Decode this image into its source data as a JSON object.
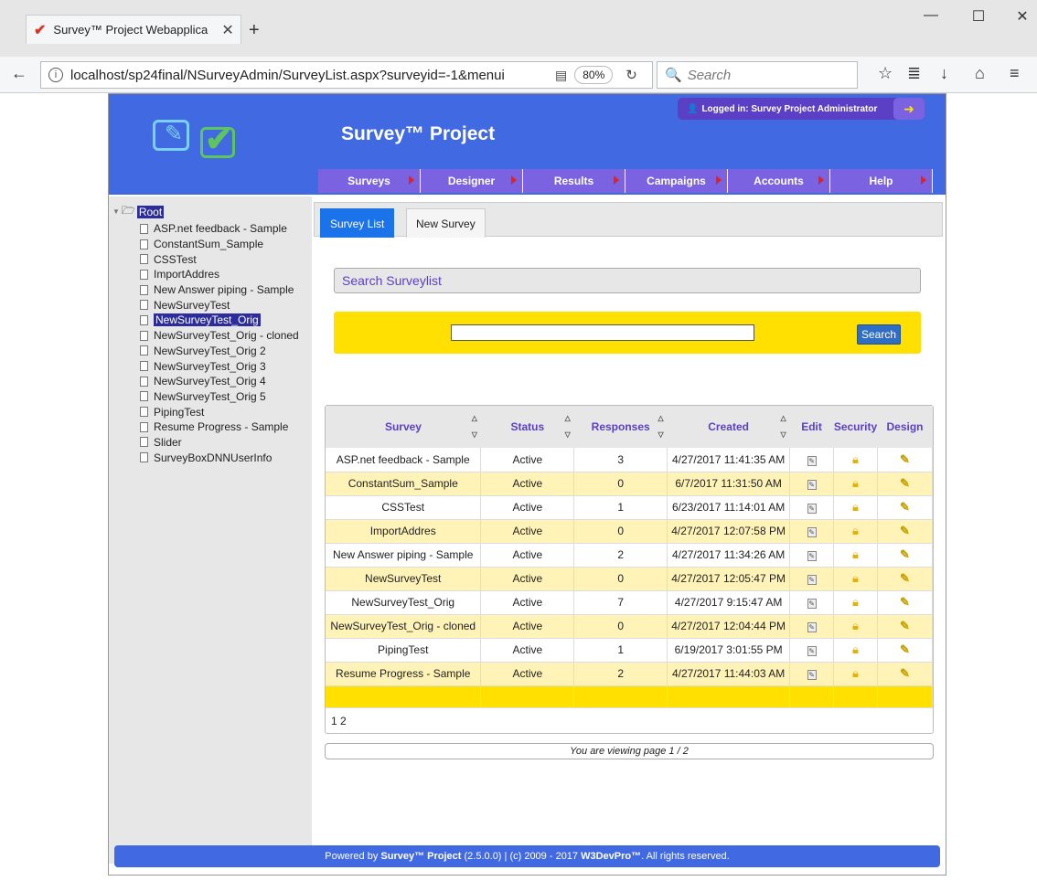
{
  "browser": {
    "tab_title": "Survey™ Project Webapplica",
    "url": "localhost/sp24final/NSurveyAdmin/SurveyList.aspx?surveyid=-1&menui",
    "zoom": "80%",
    "search_placeholder": "Search"
  },
  "header": {
    "app_title": "Survey™ Project",
    "logged_in": "Logged in: Survey Project Administrator",
    "menu": [
      "Surveys",
      "Designer",
      "Results",
      "Campaigns",
      "Accounts",
      "Help"
    ]
  },
  "tree": {
    "root": "Root",
    "items": [
      "ASP.net feedback - Sample",
      "ConstantSum_Sample",
      "CSSTest",
      "ImportAddres",
      "New Answer piping - Sample",
      "NewSurveyTest",
      "NewSurveyTest_Orig",
      "NewSurveyTest_Orig - cloned",
      "NewSurveyTest_Orig 2",
      "NewSurveyTest_Orig 3",
      "NewSurveyTest_Orig 4",
      "NewSurveyTest_Orig 5",
      "PipingTest",
      "Resume Progress - Sample",
      "Slider",
      "SurveyBoxDNNUserInfo"
    ],
    "selected": "NewSurveyTest_Orig"
  },
  "tabs": {
    "active": "Survey List",
    "inactive": "New Survey"
  },
  "search": {
    "heading": "Search Surveylist",
    "button": "Search",
    "value": ""
  },
  "grid": {
    "columns": [
      "Survey",
      "Status",
      "Responses",
      "Created",
      "Edit",
      "Security",
      "Design"
    ],
    "rows": [
      [
        "ASP.net feedback - Sample",
        "Active",
        "3",
        "4/27/2017 11:41:35 AM"
      ],
      [
        "ConstantSum_Sample",
        "Active",
        "0",
        "6/7/2017 11:31:50 AM"
      ],
      [
        "CSSTest",
        "Active",
        "1",
        "6/23/2017 11:14:01 AM"
      ],
      [
        "ImportAddres",
        "Active",
        "0",
        "4/27/2017 12:07:58 PM"
      ],
      [
        "New Answer piping - Sample",
        "Active",
        "2",
        "4/27/2017 11:34:26 AM"
      ],
      [
        "NewSurveyTest",
        "Active",
        "0",
        "4/27/2017 12:05:47 PM"
      ],
      [
        "NewSurveyTest_Orig",
        "Active",
        "7",
        "4/27/2017 9:15:47 AM"
      ],
      [
        "NewSurveyTest_Orig - cloned",
        "Active",
        "0",
        "4/27/2017 12:04:44 PM"
      ],
      [
        "PipingTest",
        "Active",
        "1",
        "6/19/2017 3:01:55 PM"
      ],
      [
        "Resume Progress - Sample",
        "Active",
        "2",
        "4/27/2017 11:44:03 AM"
      ]
    ],
    "pages": "1 2",
    "page_info": "You are viewing page 1 / 2"
  },
  "footer": {
    "prefix": "Powered by ",
    "product": "Survey™ Project",
    "middle": " (2.5.0.0) | (c) 2009 - 2017 ",
    "company": "W3DevPro™",
    "suffix": ". All rights reserved."
  }
}
